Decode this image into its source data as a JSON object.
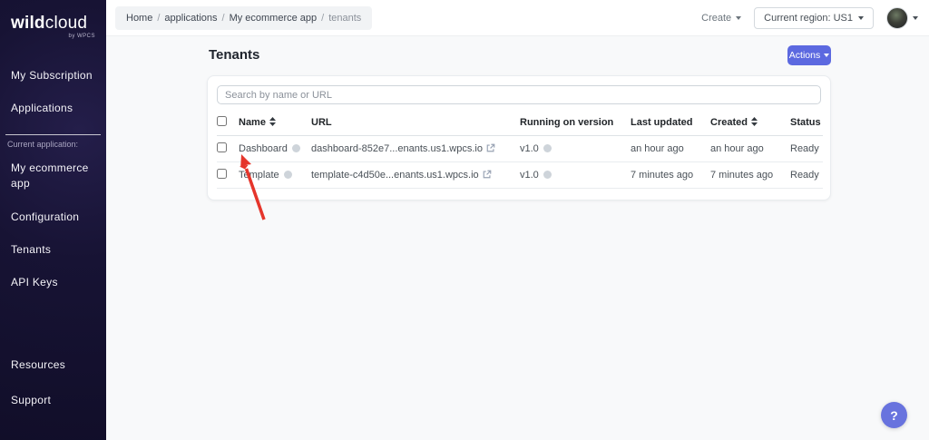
{
  "brand": {
    "name_bold": "wild",
    "name_regular": "cloud",
    "byline": "by WPCS"
  },
  "sidebar": {
    "items_top": [
      "My Subscription",
      "Applications"
    ],
    "section_label": "Current application:",
    "items_app": [
      "My ecommerce app",
      "Configuration",
      "Tenants",
      "API Keys"
    ],
    "items_bottom": [
      "Resources",
      "Support"
    ]
  },
  "topbar": {
    "breadcrumb": [
      "Home",
      "applications",
      "My ecommerce app",
      "tenants"
    ],
    "breadcrumb_separator": "/",
    "create_label": "Create",
    "region_label": "Current region: US1"
  },
  "page": {
    "title": "Tenants",
    "actions_label": "Actions"
  },
  "search": {
    "placeholder": "Search by name or URL"
  },
  "table": {
    "columns": [
      "Name",
      "URL",
      "Running on version",
      "Last updated",
      "Created",
      "Status"
    ],
    "rows": [
      {
        "name": "Dashboard",
        "url": "dashboard-852e7...enants.us1.wpcs.io",
        "version": "v1.0",
        "last_updated": "an hour ago",
        "created": "an hour ago",
        "status": "Ready"
      },
      {
        "name": "Template",
        "url": "template-c4d50e...enants.us1.wpcs.io",
        "version": "v1.0",
        "last_updated": "7 minutes ago",
        "created": "7 minutes ago",
        "status": "Ready"
      }
    ]
  },
  "help": {
    "label": "?"
  },
  "colors": {
    "accent": "#5c69e0",
    "sidebar_bg": "#151130",
    "arrow": "#e5352b",
    "status_text": "#495057"
  }
}
